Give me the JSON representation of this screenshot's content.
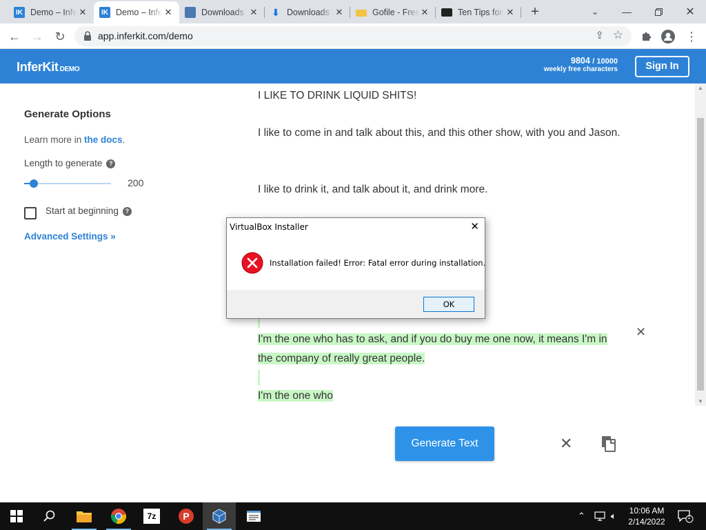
{
  "browser": {
    "tabs": [
      {
        "title": "Demo – InferKit",
        "favicon": "inferkit-favicon"
      },
      {
        "title": "Demo – InferKit",
        "favicon": "inferkit-favicon",
        "active": true
      },
      {
        "title": "Downloads",
        "favicon": "download-page-favicon"
      },
      {
        "title": "Downloads",
        "favicon": "download-arrow-icon"
      },
      {
        "title": "Gofile - Free",
        "favicon": "folder-favicon"
      },
      {
        "title": "Ten Tips for",
        "favicon": "dark-favicon"
      }
    ],
    "url": "app.inferkit.com/demo"
  },
  "header": {
    "logo": "InferKit",
    "logo_badge": "DEMO",
    "char_count": "9804",
    "char_max": "/ 10000",
    "char_label": "weekly free characters",
    "signin": "Sign In",
    "brand_color": "#2d82d6"
  },
  "sidebar": {
    "title": "Generate Options",
    "learn_prefix": "Learn more in ",
    "learn_link": "the docs",
    "learn_suffix": ".",
    "length_label": "Length to generate",
    "length_value": "200",
    "length_fraction": 0.06,
    "start_label": "Start at beginning",
    "start_checked": false,
    "advanced": "Advanced Settings »"
  },
  "content": {
    "p1": "I LIKE TO DRINK LIQUID SHITS!",
    "p2": "I like to come in and talk about this, and this other show, with you and Jason.",
    "p3": "I like to drink it, and talk about it, and drink more.",
    "p4": "I'm the one who has to ask, and if you do buy me one now, it means I'm in the company of really great people.",
    "p5": "I'm the one who",
    "generate_button": "Generate Text"
  },
  "dialog": {
    "title": "VirtualBox Installer",
    "message": "Installation failed! Error: Fatal error during installation.",
    "ok": "OK"
  },
  "taskbar": {
    "apps": [
      "file-explorer-icon",
      "chrome-icon",
      "7zip-icon",
      "psiphon-icon",
      "virtualbox-icon",
      "notepad-icon"
    ],
    "time": "10:06 AM",
    "date": "2/14/2022",
    "notification_count": "1"
  }
}
